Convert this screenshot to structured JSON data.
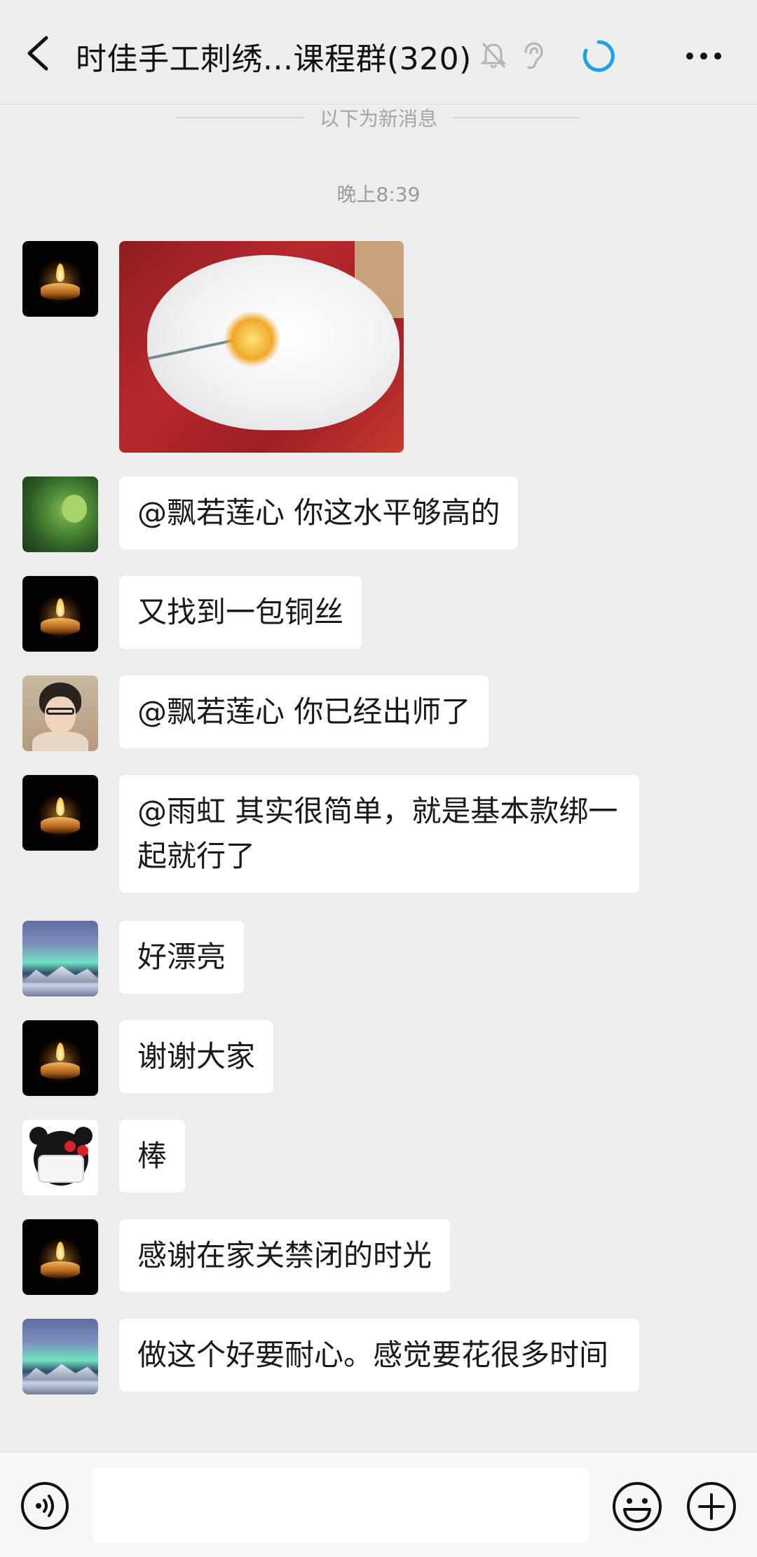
{
  "header": {
    "title": "时佳手工刺绣...课程群(320)"
  },
  "divider_text": "以下为新消息",
  "timestamp": "晚上8:39",
  "messages": [
    {
      "avatar": "candle-avatar",
      "type": "image"
    },
    {
      "avatar": "leaf-avatar",
      "text": "@飘若莲心  你这水平够高的"
    },
    {
      "avatar": "candle-avatar",
      "text": "又找到一包铜丝"
    },
    {
      "avatar": "person-avatar",
      "text": "@飘若莲心  你已经出师了"
    },
    {
      "avatar": "candle-avatar",
      "text": "@雨虹  其实很简单，就是基本款绑一起就行了"
    },
    {
      "avatar": "aurora-avatar",
      "text": "好漂亮"
    },
    {
      "avatar": "candle-avatar",
      "text": "谢谢大家"
    },
    {
      "avatar": "bear-avatar",
      "text": "棒"
    },
    {
      "avatar": "candle-avatar",
      "text": "感谢在家关禁闭的时光"
    },
    {
      "avatar": "aurora-avatar",
      "text": "做这个好要耐心。感觉要花很多时间"
    }
  ],
  "colors": {
    "background": "#ededed",
    "bubble": "#ffffff",
    "spinner": "#1aa1e6"
  },
  "icons": [
    "back-arrow-icon",
    "mute-bell-icon",
    "ear-icon",
    "loading-spinner-icon",
    "more-icon",
    "voice-icon",
    "emoji-icon",
    "plus-icon"
  ]
}
